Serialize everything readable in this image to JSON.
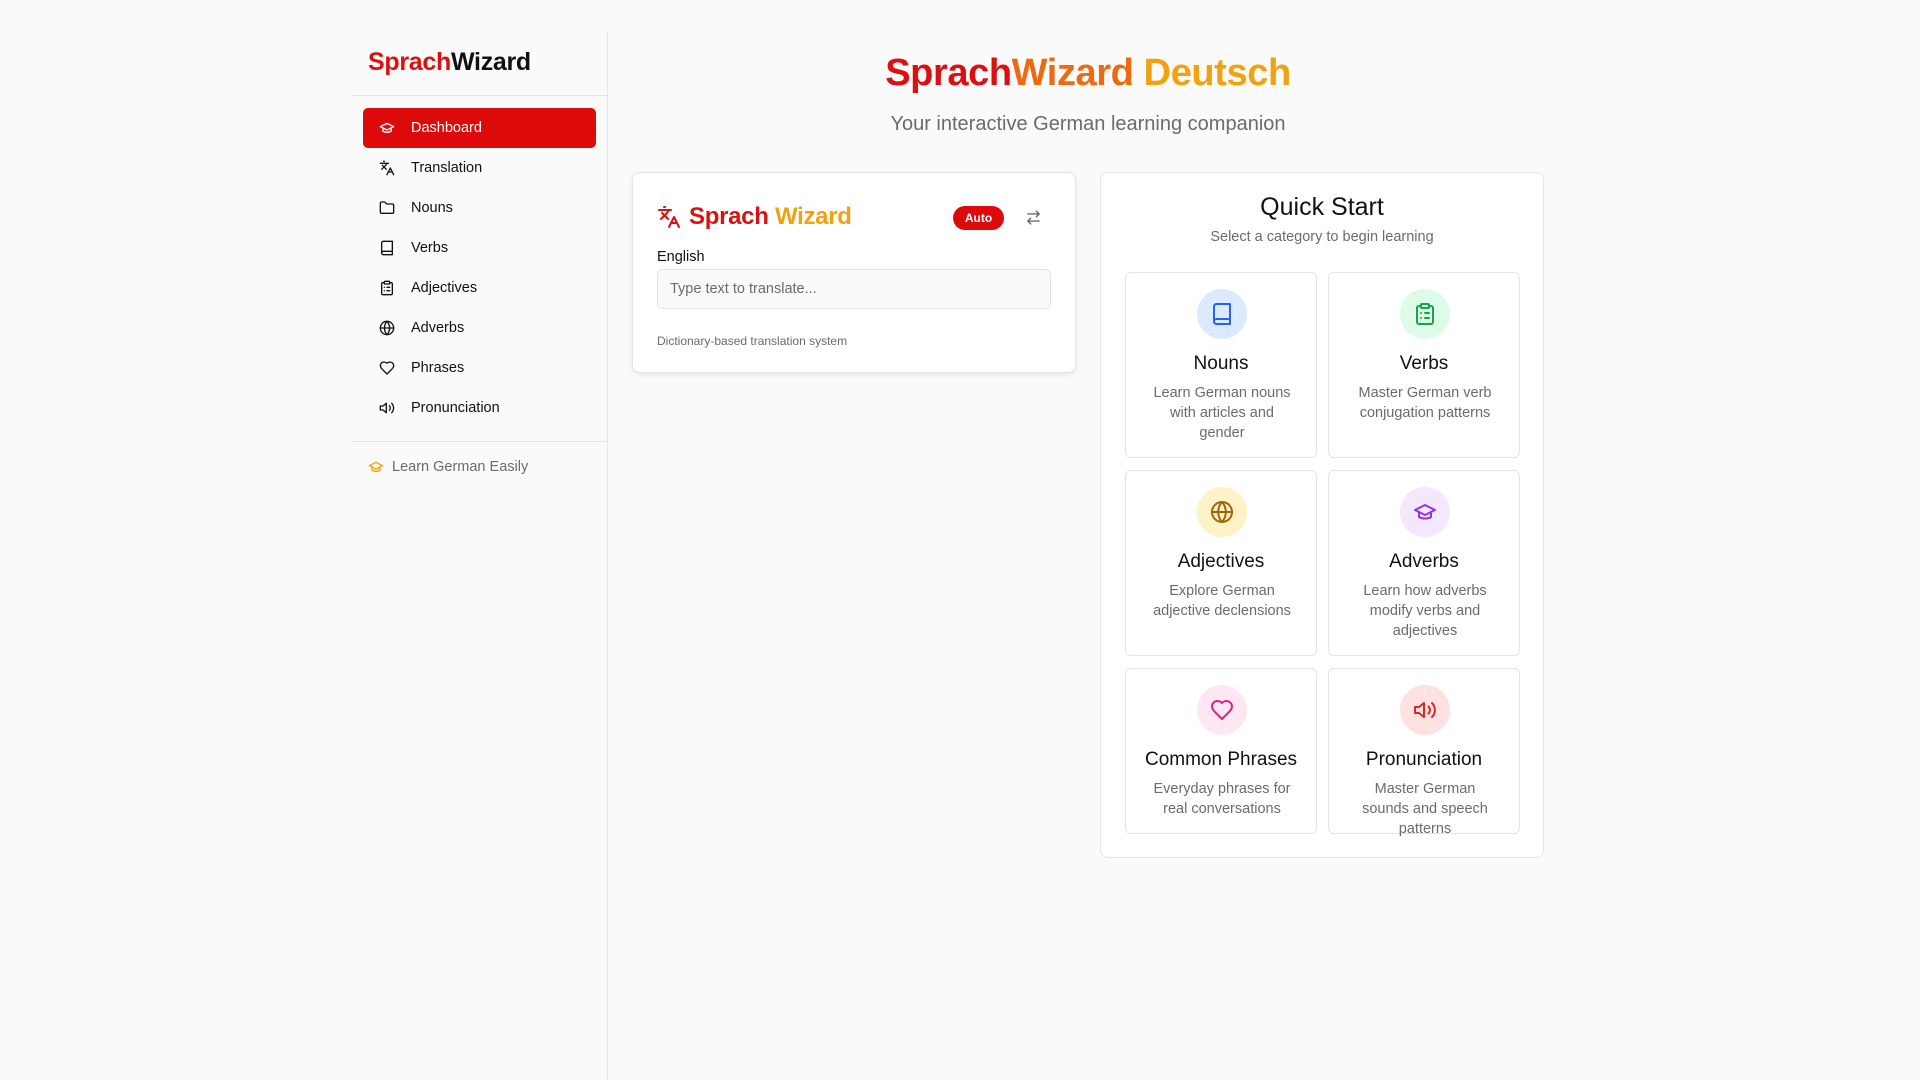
{
  "sidebar": {
    "brand": {
      "part1": "Sprach",
      "part2": "Wizard"
    },
    "items": [
      {
        "label": "Dashboard",
        "icon": "graduation-cap-icon",
        "active": true
      },
      {
        "label": "Translation",
        "icon": "languages-icon"
      },
      {
        "label": "Nouns",
        "icon": "folder-icon"
      },
      {
        "label": "Verbs",
        "icon": "book-icon"
      },
      {
        "label": "Adjectives",
        "icon": "clipboard-icon"
      },
      {
        "label": "Adverbs",
        "icon": "globe-icon"
      },
      {
        "label": "Phrases",
        "icon": "heart-icon"
      },
      {
        "label": "Pronunciation",
        "icon": "speaker-icon"
      }
    ],
    "footer": "Learn German Easily"
  },
  "header": {
    "title_part1": "Sprach",
    "title_part2": "Wizard",
    "title_part3": "Deutsch",
    "subtitle": "Your interactive German learning companion"
  },
  "translator": {
    "title_part1": "Sprach",
    "title_part2": "Wizard",
    "badge": "Auto",
    "language_label": "English",
    "input_value": "",
    "input_placeholder": "Type text to translate...",
    "footer": "Dictionary-based translation system"
  },
  "quick_start": {
    "title": "Quick Start",
    "subtitle": "Select a category to begin learning",
    "tiles": [
      {
        "title": "Nouns",
        "desc": "Learn German nouns with articles and gender",
        "icon": "book-icon",
        "bg": "#dbeafe",
        "fg": "#2563eb"
      },
      {
        "title": "Verbs",
        "desc": "Master German verb conjugation patterns",
        "icon": "clipboard-icon",
        "bg": "#dcfce7",
        "fg": "#16a34a"
      },
      {
        "title": "Adjectives",
        "desc": "Explore German adjective declensions",
        "icon": "globe-icon",
        "bg": "#fef3c7",
        "fg": "#a16207"
      },
      {
        "title": "Adverbs",
        "desc": "Learn how adverbs modify verbs and adjectives",
        "icon": "graduation-cap-icon",
        "bg": "#f3e8ff",
        "fg": "#9333ea"
      },
      {
        "title": "Common Phrases",
        "desc": "Everyday phrases for real conversations",
        "icon": "heart-icon",
        "bg": "#fce7f3",
        "fg": "#db2777"
      },
      {
        "title": "Pronunciation",
        "desc": "Master German sounds and speech patterns",
        "icon": "speaker-icon",
        "bg": "#fee2e2",
        "fg": "#dc2626"
      }
    ]
  },
  "colors": {
    "accent_red": "#dc0a0a",
    "accent_orange": "#f29a10",
    "muted_text": "#6b6b6b",
    "border": "#e4e4e7"
  }
}
